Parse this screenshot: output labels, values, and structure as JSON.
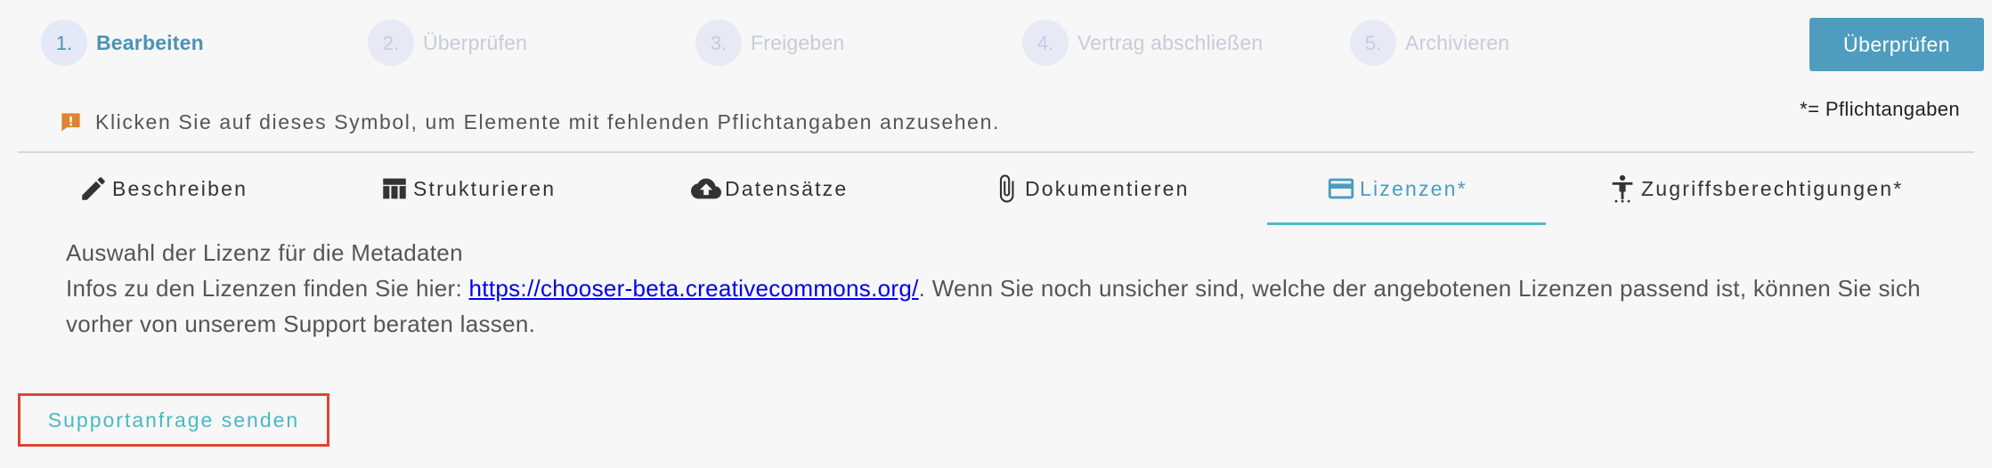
{
  "stepper": {
    "steps": [
      {
        "number": "1.",
        "label": "Bearbeiten",
        "active": true
      },
      {
        "number": "2.",
        "label": "Überprüfen"
      },
      {
        "number": "3.",
        "label": "Freigeben"
      },
      {
        "number": "4.",
        "label": "Vertrag abschließen"
      },
      {
        "number": "5.",
        "label": "Archivieren"
      }
    ],
    "review_button": "Überprüfen"
  },
  "hint": {
    "text": "Klicken Sie auf dieses Symbol, um Elemente mit fehlenden Pflichtangaben anzusehen.",
    "icon": "warning-comment-icon",
    "icon_color": "#e0822f"
  },
  "required_note": "*= Pflichtangaben",
  "tabs": [
    {
      "label": "Beschreiben",
      "icon": "pencil-icon"
    },
    {
      "label": "Strukturieren",
      "icon": "table-icon"
    },
    {
      "label": "Datensätze",
      "icon": "cloud-upload-icon"
    },
    {
      "label": "Dokumentieren",
      "icon": "paperclip-icon"
    },
    {
      "label": "Lizenzen*",
      "icon": "credit-card-icon",
      "active": true
    },
    {
      "label": "Zugriffsberechtigungen*",
      "icon": "accessibility-icon"
    }
  ],
  "content": {
    "line1": "Auswahl der Lizenz für die Metadaten",
    "line2_prefix": "Infos zu den Lizenzen finden Sie hier: ",
    "link": "https://chooser-beta.creativecommons.org/",
    "line2_suffix": ". Wenn Sie noch unsicher sind, welche der angebotenen Lizenzen passend ist, können Sie sich vorher von unserem Support beraten lassen."
  },
  "support_button": "Supportanfrage senden",
  "colors": {
    "accent": "#4a93b5",
    "tab_active": "#4a9dc0",
    "underline": "#4dbdc6",
    "highlight_border": "#e0452f"
  }
}
